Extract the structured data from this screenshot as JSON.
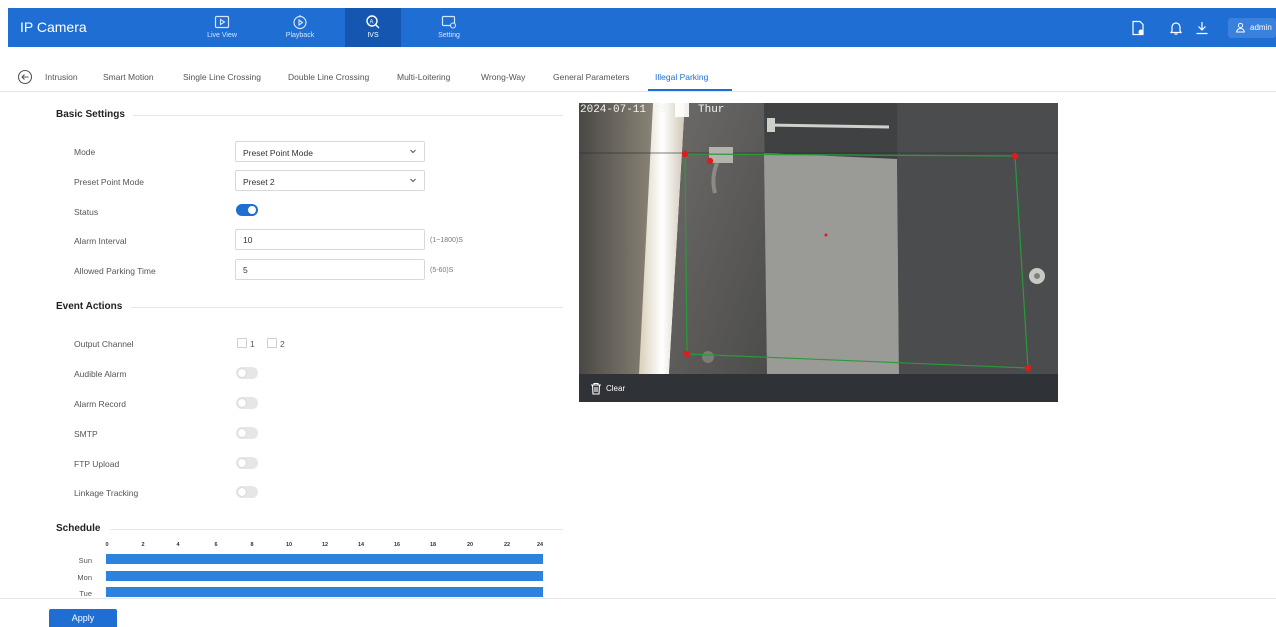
{
  "header": {
    "app_title": "IP Camera",
    "nav": [
      {
        "label": "Live View",
        "icon": "live-view-icon"
      },
      {
        "label": "Playback",
        "icon": "playback-icon"
      },
      {
        "label": "IVS",
        "icon": "ivs-icon",
        "active": true
      },
      {
        "label": "Setting",
        "icon": "setting-icon"
      }
    ],
    "user": "admin",
    "colors": {
      "bar": "#1f6ed4",
      "active": "#1557b0"
    }
  },
  "tabs": [
    {
      "label": "Intrusion"
    },
    {
      "label": "Smart Motion"
    },
    {
      "label": "Single Line Crossing"
    },
    {
      "label": "Double Line Crossing"
    },
    {
      "label": "Multi-Loitering"
    },
    {
      "label": "Wrong-Way"
    },
    {
      "label": "General Parameters"
    },
    {
      "label": "Illegal Parking",
      "active": true
    }
  ],
  "basic": {
    "title": "Basic Settings",
    "mode_label": "Mode",
    "mode_value": "Preset Point Mode",
    "preset_label": "Preset Point Mode",
    "preset_value": "Preset 2",
    "status_label": "Status",
    "status_on": true,
    "alarm_interval_label": "Alarm Interval",
    "alarm_interval_value": "10",
    "alarm_interval_hint": "(1~1800)S",
    "parking_time_label": "Allowed Parking Time",
    "parking_time_value": "5",
    "parking_time_hint": "(5-60)S"
  },
  "events": {
    "title": "Event Actions",
    "output_channel_label": "Output Channel",
    "channels": [
      "1",
      "2"
    ],
    "audible_label": "Audible Alarm",
    "record_label": "Alarm Record",
    "smtp_label": "SMTP",
    "ftp_label": "FTP Upload",
    "tracking_label": "Linkage Tracking"
  },
  "schedule": {
    "title": "Schedule",
    "hours": [
      "0",
      "2",
      "4",
      "6",
      "8",
      "10",
      "12",
      "14",
      "16",
      "18",
      "20",
      "22",
      "24"
    ],
    "days": [
      "Sun",
      "Mon",
      "Tue"
    ],
    "bar_color": "#2d82dd"
  },
  "video": {
    "osd_date": "2024-07-11 08:",
    "osd_day": "Thur",
    "clear_label": "Clear"
  },
  "apply_label": "Apply"
}
